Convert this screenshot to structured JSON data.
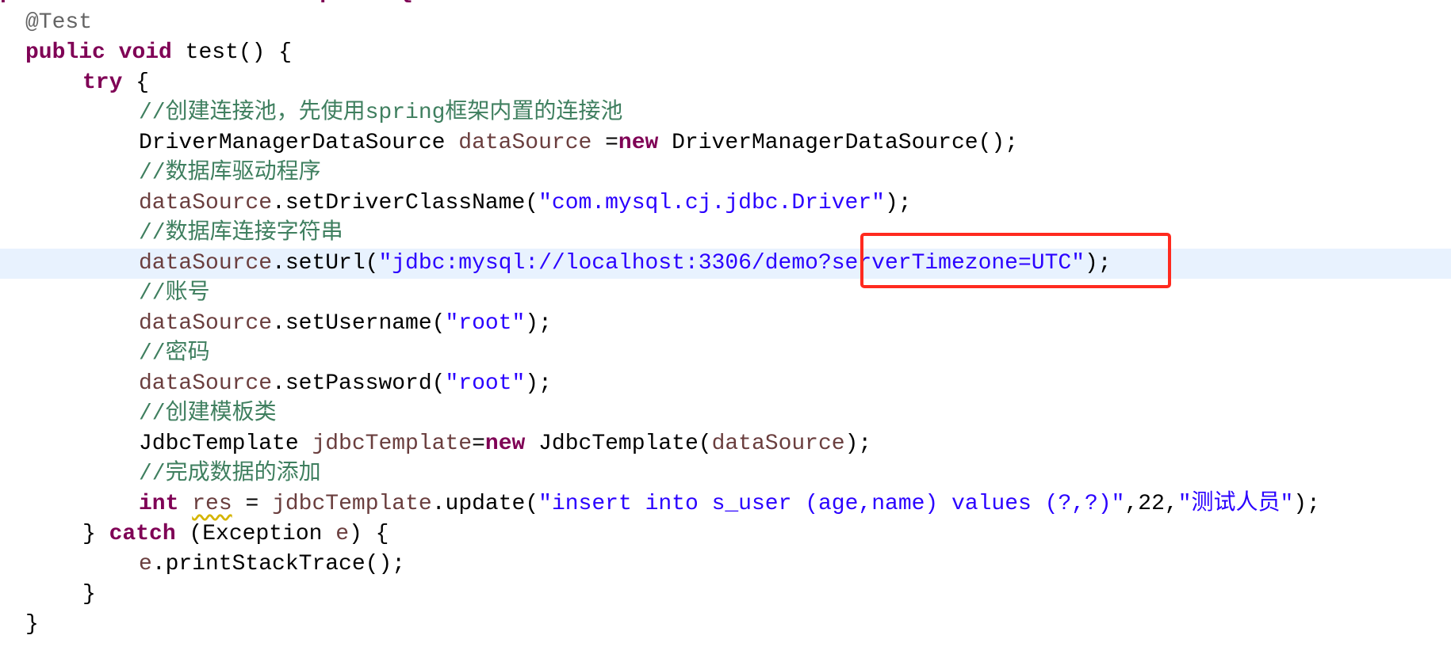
{
  "editor": {
    "current_line": 9,
    "highlight_color": "#ff2a1f",
    "lines": [
      {
        "indent": 0,
        "tokens": [
          {
            "t": "public class TestJdbcTemplate {",
            "c": "kw"
          }
        ]
      },
      {
        "indent": 1,
        "tokens": [
          {
            "t": "@Test",
            "c": "ann"
          }
        ]
      },
      {
        "indent": 1,
        "tokens": [
          {
            "t": "public",
            "c": "kw"
          },
          {
            "t": " "
          },
          {
            "t": "void",
            "c": "kw"
          },
          {
            "t": " test() {"
          }
        ]
      },
      {
        "indent": 2,
        "tokens": [
          {
            "t": "try",
            "c": "kw"
          },
          {
            "t": " {"
          }
        ]
      },
      {
        "indent": 3,
        "tokens": [
          {
            "t": "//创建连接池，先使用spring框架内置的连接池",
            "c": "cm"
          }
        ]
      },
      {
        "indent": 3,
        "tokens": [
          {
            "t": "DriverManagerDataSource "
          },
          {
            "t": "dataSource",
            "c": "var"
          },
          {
            "t": " ="
          },
          {
            "t": "new",
            "c": "kw"
          },
          {
            "t": " DriverManagerDataSource();"
          }
        ]
      },
      {
        "indent": 3,
        "tokens": [
          {
            "t": "//数据库驱动程序",
            "c": "cm"
          }
        ]
      },
      {
        "indent": 3,
        "tokens": [
          {
            "t": "dataSource",
            "c": "var"
          },
          {
            "t": ".setDriverClassName("
          },
          {
            "t": "\"com.mysql.cj.jdbc.Driver\"",
            "c": "str"
          },
          {
            "t": ");"
          }
        ]
      },
      {
        "indent": 3,
        "tokens": [
          {
            "t": "//数据库连接字符串",
            "c": "cm"
          }
        ]
      },
      {
        "indent": 3,
        "tokens": [
          {
            "t": "dataSource",
            "c": "var"
          },
          {
            "t": ".setUrl("
          },
          {
            "t": "\"jdbc:mysql://localhost:3306/demo?serverTimezone=UTC\"",
            "c": "str"
          },
          {
            "t": ");"
          }
        ]
      },
      {
        "indent": 3,
        "tokens": [
          {
            "t": "//账号",
            "c": "cm"
          }
        ]
      },
      {
        "indent": 3,
        "tokens": [
          {
            "t": "dataSource",
            "c": "var"
          },
          {
            "t": ".setUsername("
          },
          {
            "t": "\"root\"",
            "c": "str"
          },
          {
            "t": ");"
          }
        ]
      },
      {
        "indent": 3,
        "tokens": [
          {
            "t": "//密码",
            "c": "cm"
          }
        ]
      },
      {
        "indent": 3,
        "tokens": [
          {
            "t": "dataSource",
            "c": "var"
          },
          {
            "t": ".setPassword("
          },
          {
            "t": "\"root\"",
            "c": "str"
          },
          {
            "t": ");"
          }
        ]
      },
      {
        "indent": 3,
        "tokens": [
          {
            "t": "//创建模板类",
            "c": "cm"
          }
        ]
      },
      {
        "indent": 3,
        "tokens": [
          {
            "t": "JdbcTemplate "
          },
          {
            "t": "jdbcTemplate",
            "c": "var"
          },
          {
            "t": "="
          },
          {
            "t": "new",
            "c": "kw"
          },
          {
            "t": " JdbcTemplate("
          },
          {
            "t": "dataSource",
            "c": "var"
          },
          {
            "t": ");"
          }
        ]
      },
      {
        "indent": 3,
        "tokens": [
          {
            "t": "//完成数据的添加",
            "c": "cm"
          }
        ]
      },
      {
        "indent": 3,
        "tokens": [
          {
            "t": "int",
            "c": "kw"
          },
          {
            "t": " "
          },
          {
            "t": "res",
            "c": "var warn"
          },
          {
            "t": " = "
          },
          {
            "t": "jdbcTemplate",
            "c": "var"
          },
          {
            "t": ".update("
          },
          {
            "t": "\"insert into s_user (age,name) values (?,?)\"",
            "c": "str"
          },
          {
            "t": ",22,"
          },
          {
            "t": "\"测试人员\"",
            "c": "str"
          },
          {
            "t": ");"
          }
        ]
      },
      {
        "indent": 2,
        "tokens": [
          {
            "t": "} "
          },
          {
            "t": "catch",
            "c": "kw"
          },
          {
            "t": " (Exception "
          },
          {
            "t": "e",
            "c": "var"
          },
          {
            "t": ") {"
          }
        ]
      },
      {
        "indent": 3,
        "tokens": [
          {
            "t": "e",
            "c": "var"
          },
          {
            "t": ".printStackTrace();"
          }
        ]
      },
      {
        "indent": 2,
        "tokens": [
          {
            "t": "}"
          }
        ]
      },
      {
        "indent": 1,
        "tokens": [
          {
            "t": "}"
          }
        ]
      }
    ]
  }
}
